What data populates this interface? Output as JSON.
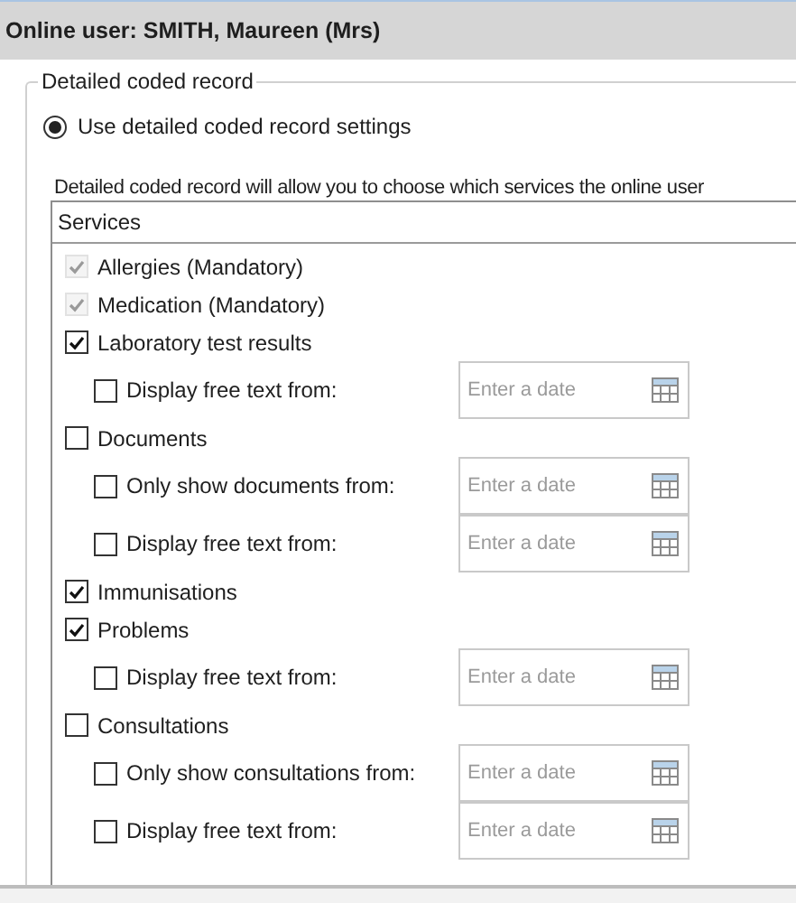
{
  "header": {
    "title": "Online user: SMITH, Maureen (Mrs)"
  },
  "group": {
    "title": "Detailed coded record",
    "option": {
      "label": "Use detailed coded record settings",
      "selected": true
    },
    "description": "Detailed coded record will allow you to choose which services the online user",
    "services": {
      "heading": "Services",
      "items": [
        {
          "label": "Allergies (Mandatory)",
          "checked": true,
          "disabled": true
        },
        {
          "label": "Medication (Mandatory)",
          "checked": true,
          "disabled": true
        },
        {
          "label": "Laboratory test results",
          "checked": true,
          "disabled": false,
          "children": [
            {
              "label": "Display free text from:",
              "checked": false,
              "placeholder": "Enter a date"
            }
          ]
        },
        {
          "label": "Documents",
          "checked": false,
          "disabled": false,
          "children": [
            {
              "label": "Only show documents from:",
              "checked": false,
              "placeholder": "Enter a date"
            },
            {
              "label": "Display free text from:",
              "checked": false,
              "placeholder": "Enter a date"
            }
          ]
        },
        {
          "label": "Immunisations",
          "checked": true,
          "disabled": false
        },
        {
          "label": "Problems",
          "checked": true,
          "disabled": false,
          "children": [
            {
              "label": "Display free text from:",
              "checked": false,
              "placeholder": "Enter a date"
            }
          ]
        },
        {
          "label": "Consultations",
          "checked": false,
          "disabled": false,
          "children": [
            {
              "label": "Only show consultations from:",
              "checked": false,
              "placeholder": "Enter a date"
            },
            {
              "label": "Display free text from:",
              "checked": false,
              "placeholder": "Enter a date"
            }
          ]
        }
      ]
    }
  }
}
